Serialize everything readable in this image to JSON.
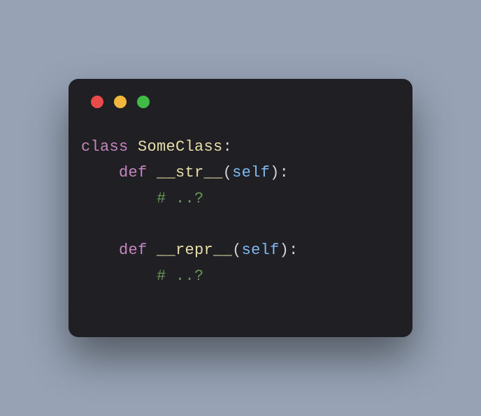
{
  "code": {
    "line1": {
      "kw_class": "class",
      "cls_name": "SomeClass",
      "colon": ":"
    },
    "line2": {
      "indent": "    ",
      "kw_def": "def",
      "fn_name": "__str__",
      "open_paren": "(",
      "param": "self",
      "close_paren": ")",
      "colon": ":"
    },
    "line3": {
      "indent": "        ",
      "comment": "# ..?"
    },
    "line5": {
      "indent": "    ",
      "kw_def": "def",
      "fn_name": "__repr__",
      "open_paren": "(",
      "param": "self",
      "close_paren": ")",
      "colon": ":"
    },
    "line6": {
      "indent": "        ",
      "comment": "# ..?"
    }
  }
}
